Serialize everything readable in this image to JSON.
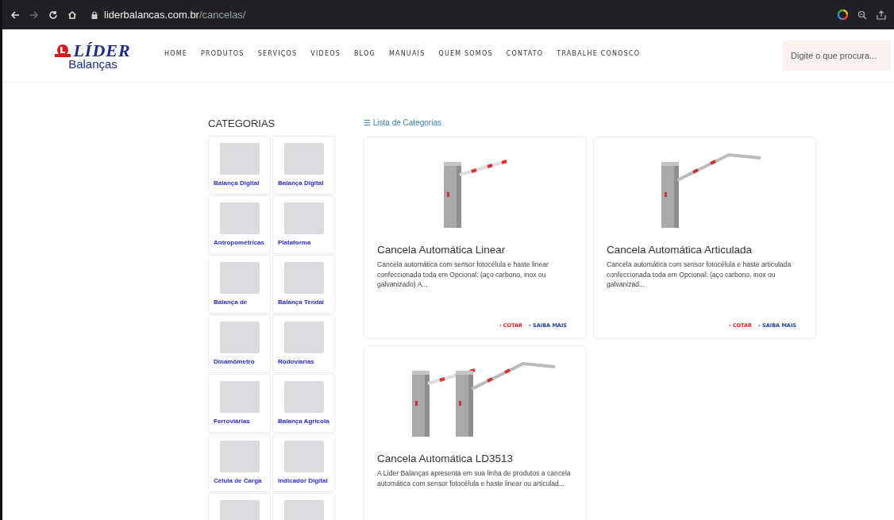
{
  "browser": {
    "buttons": [
      {
        "kind": "back",
        "disabled": false
      },
      {
        "kind": "forward",
        "disabled": true
      },
      {
        "kind": "reload",
        "disabled": false
      },
      {
        "kind": "home",
        "disabled": false
      }
    ],
    "url_domain": "liderbalancas.com.br",
    "url_path": "/cancelas/"
  },
  "header": {
    "logo_top": "LÍDER",
    "logo_bottom": "Balanças",
    "nav": [
      "HOME",
      "PRODUTOS",
      "SERVIÇOS",
      "VIDEOS",
      "BLOG",
      "MANUAIS",
      "QUEM SOMOS",
      "CONTATO",
      "TRABALHE CONOSCO"
    ],
    "search": {
      "placeholder": "Digite o que procura..."
    }
  },
  "categories": {
    "title": "CATEGORIAS",
    "items": [
      {
        "kind": "labeled",
        "label": "Balança Digital"
      },
      {
        "kind": "labeled",
        "label": "Balança Digital"
      },
      {
        "kind": "labeled",
        "label": "Antropométricas"
      },
      {
        "kind": "labeled",
        "label": "Plataforma"
      },
      {
        "kind": "labeled",
        "label": "Balança de"
      },
      {
        "kind": "labeled",
        "label": "Balança Tendal"
      },
      {
        "kind": "labeled",
        "label": "Dinamômetro"
      },
      {
        "kind": "labeled",
        "label": "Rodoviarias"
      },
      {
        "kind": "labeled",
        "label": "Ferroviárias"
      },
      {
        "kind": "labeled",
        "label": "Balança Agricola"
      },
      {
        "kind": "labeled",
        "label": "Célula de Carga"
      },
      {
        "kind": "labeled",
        "label": "Indicador Digital"
      },
      {
        "kind": "photo_only"
      },
      {
        "kind": "photo_only"
      }
    ]
  },
  "category_list_link": "☰ Lista de Categorias",
  "products": [
    {
      "kind": "linear",
      "title": "Cancela Automática Linear",
      "description": "Cancela automática com sensor fotocélula e haste linear confeccionada toda em Opcional: (aço carbono, inox ou galvanizado) A...",
      "quote": "› COTAR",
      "more": "› SAIBA MAIS"
    },
    {
      "kind": "articulated",
      "title": "Cancela Automática Articulada",
      "description": "Cancela automática com sensor fotocélula e haste articulada confeccionada toda em Opcional: (aço carbono, inox ou galvanizad...",
      "quote": "› COTAR",
      "more": "› SAIBA MAIS"
    },
    {
      "kind": "pair",
      "title": "Cancela Automática LD3513",
      "description": "A Líder Balanças apresenta em sua linha de produtos a cancela automática com sensor fotocélula e haste linear ou articulad..."
    }
  ]
}
